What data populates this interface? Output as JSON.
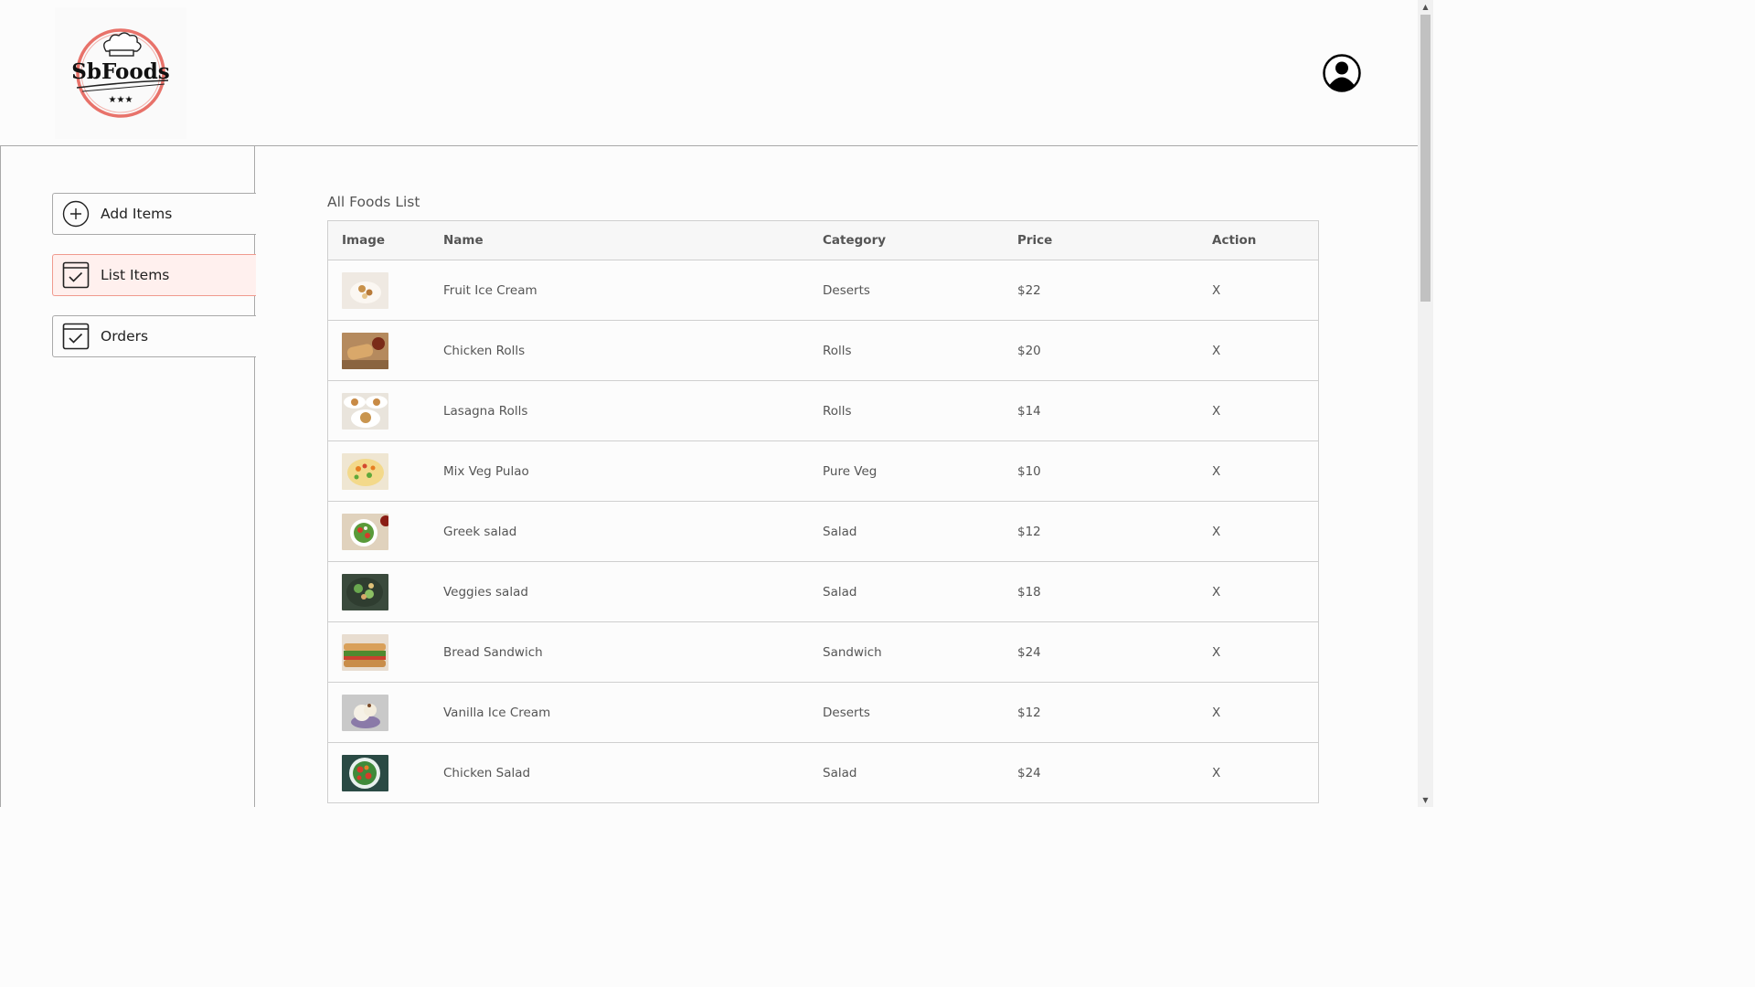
{
  "header": {
    "logo_text": "SbFoods",
    "logo_icon": "chef-hat-logo-icon",
    "profile_icon": "user-profile-icon"
  },
  "sidebar": {
    "items": [
      {
        "label": "Add Items",
        "icon": "plus-circle-icon",
        "active": false
      },
      {
        "label": "List Items",
        "icon": "checkbox-icon",
        "active": true
      },
      {
        "label": "Orders",
        "icon": "checkbox-icon",
        "active": false
      }
    ]
  },
  "main": {
    "title": "All Foods List",
    "columns": [
      "Image",
      "Name",
      "Category",
      "Price",
      "Action"
    ],
    "rows": [
      {
        "name": "Fruit Ice Cream",
        "category": "Deserts",
        "price": "$22",
        "action": "X"
      },
      {
        "name": "Chicken Rolls",
        "category": "Rolls",
        "price": "$20",
        "action": "X"
      },
      {
        "name": "Lasagna Rolls",
        "category": "Rolls",
        "price": "$14",
        "action": "X"
      },
      {
        "name": "Mix Veg Pulao",
        "category": "Pure Veg",
        "price": "$10",
        "action": "X"
      },
      {
        "name": "Greek salad",
        "category": "Salad",
        "price": "$12",
        "action": "X"
      },
      {
        "name": "Veggies salad",
        "category": "Salad",
        "price": "$18",
        "action": "X"
      },
      {
        "name": "Bread Sandwich",
        "category": "Sandwich",
        "price": "$24",
        "action": "X"
      },
      {
        "name": "Vanilla Ice Cream",
        "category": "Deserts",
        "price": "$12",
        "action": "X"
      },
      {
        "name": "Chicken Salad",
        "category": "Salad",
        "price": "$24",
        "action": "X"
      }
    ]
  },
  "colors": {
    "accent": "#f09a8e",
    "active_bg": "#fff0ee",
    "border": "#a9a9a9",
    "logo_ring": "#e8726a"
  }
}
